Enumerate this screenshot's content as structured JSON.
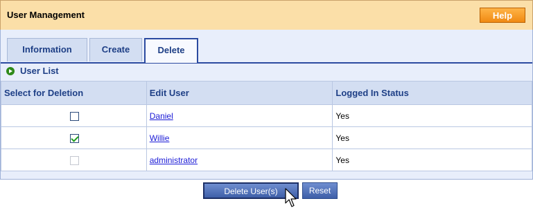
{
  "header": {
    "title": "User Management",
    "help_label": "Help"
  },
  "tabs": [
    {
      "label": "Information",
      "active": false
    },
    {
      "label": "Create",
      "active": false
    },
    {
      "label": "Delete",
      "active": true
    }
  ],
  "section": {
    "title": "User List",
    "icon": "arrow-circle-icon"
  },
  "table": {
    "columns": [
      "Select for Deletion",
      "Edit User",
      "Logged In Status"
    ],
    "rows": [
      {
        "selected": false,
        "disabled": false,
        "user": "Daniel",
        "status": "Yes"
      },
      {
        "selected": true,
        "disabled": false,
        "user": "Willie",
        "status": "Yes"
      },
      {
        "selected": false,
        "disabled": true,
        "user": "administrator",
        "status": "Yes"
      }
    ]
  },
  "actions": {
    "delete_label": "Delete User(s)",
    "reset_label": "Reset"
  },
  "colors": {
    "header_bg": "#fbdfa8",
    "help_button": "#f08a12",
    "tab_accent": "#2b4aa0",
    "link": "#1a1ad6",
    "check": "#1f9e1f"
  }
}
